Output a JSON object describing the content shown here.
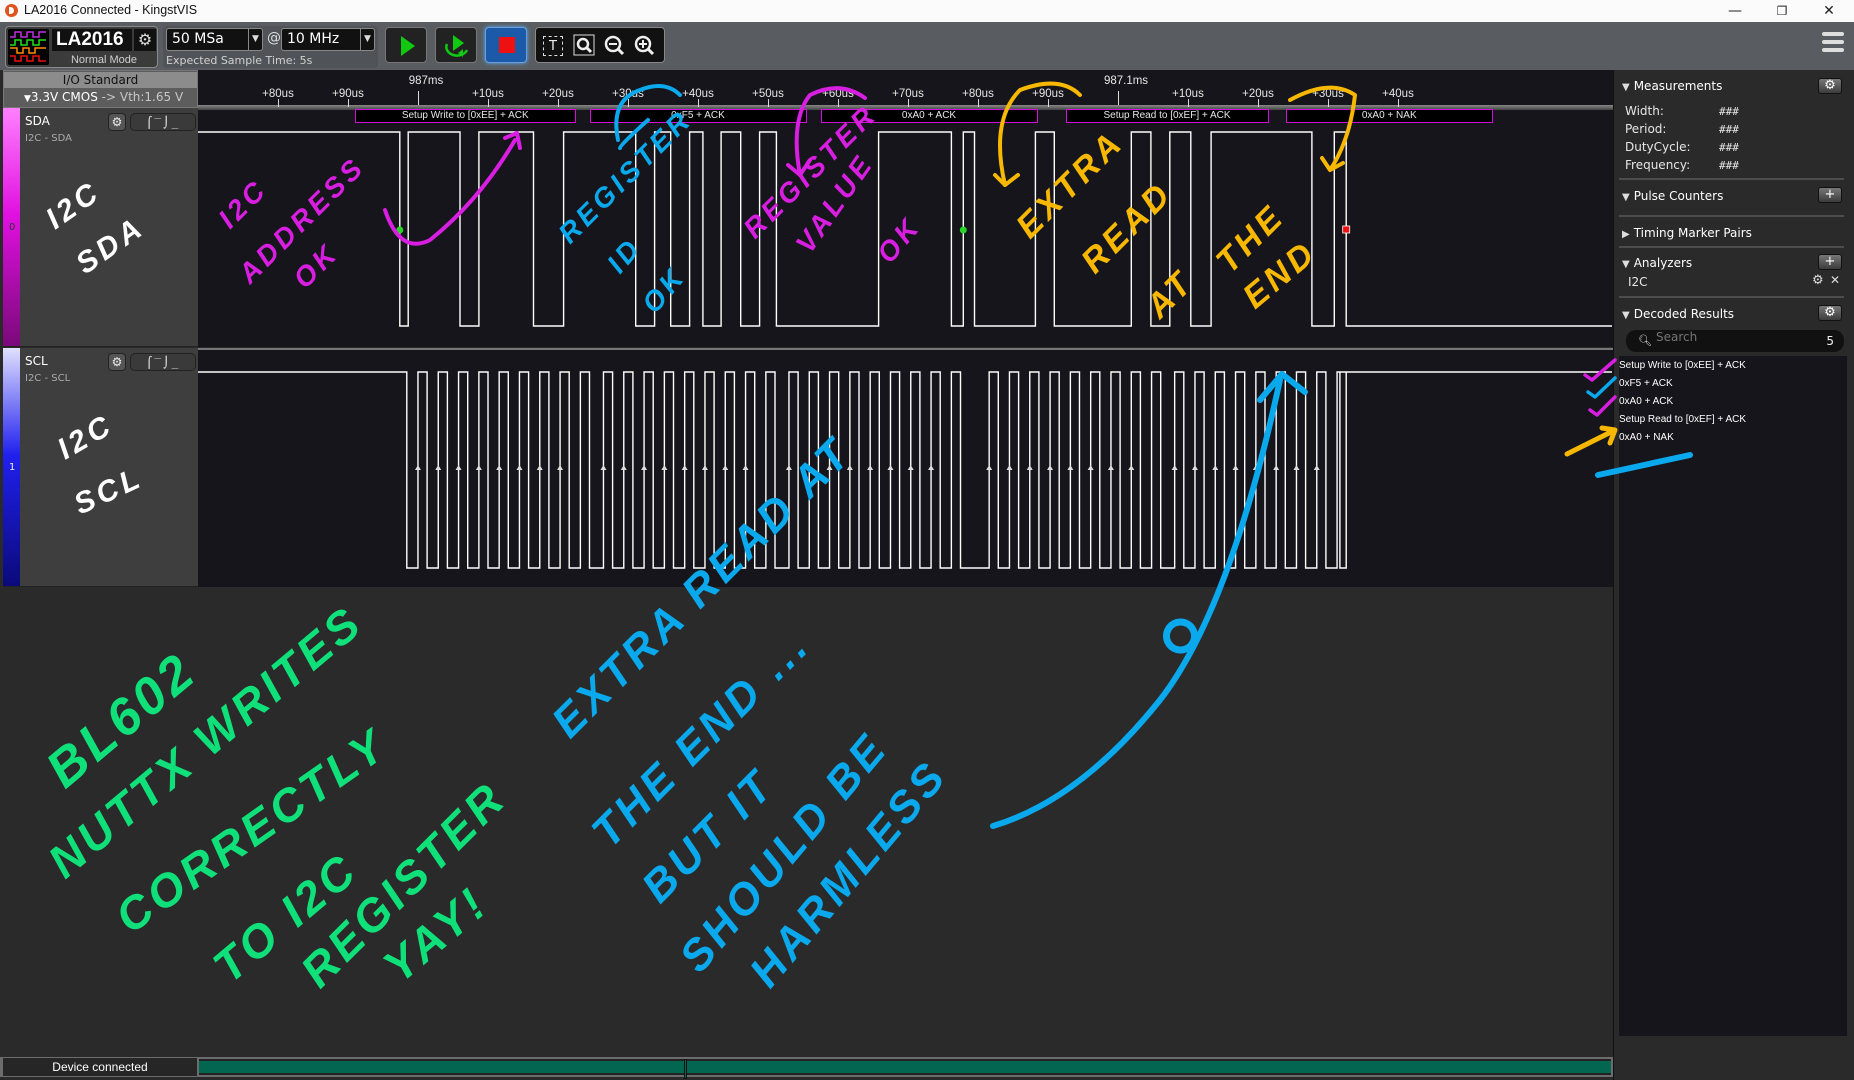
{
  "window": {
    "title": "LA2016 Connected - KingstVIS",
    "minimize": "—",
    "restore": "❐",
    "close": "✕"
  },
  "toolbar": {
    "device_name": "LA2016",
    "device_mode": "Normal Mode",
    "sample_depth": "50 MSa",
    "at_symbol": "@",
    "sample_rate": "10 MHz",
    "expected_time": "Expected Sample Time: 5s",
    "start_label": "Start",
    "repeat_label": "Repeat",
    "stop_label": "Stop",
    "colors": {
      "start": "#12c912",
      "stop_bg": "#1a5aa8",
      "stop": "#ee1111"
    }
  },
  "io_standard": {
    "label": "I/O Standard",
    "value": "3.3V CMOS",
    "threshold": "-> Vth:1.65 V"
  },
  "ruler": {
    "ticks": [
      {
        "label": "+80us",
        "t": -20
      },
      {
        "label": "+90us",
        "t": -10
      },
      {
        "label": "+10us",
        "t": 10
      },
      {
        "label": "+20us",
        "t": 20
      },
      {
        "label": "+30us",
        "t": 30
      },
      {
        "label": "+40us",
        "t": 40
      },
      {
        "label": "+50us",
        "t": 50
      },
      {
        "label": "+60us",
        "t": 60
      },
      {
        "label": "+70us",
        "t": 70
      },
      {
        "label": "+80us",
        "t": 80
      },
      {
        "label": "+90us",
        "t": 90
      },
      {
        "label": "+10us",
        "t": 110
      },
      {
        "label": "+20us",
        "t": 120
      },
      {
        "label": "+30us",
        "t": 130
      },
      {
        "label": "+40us",
        "t": 140
      }
    ],
    "anchors": [
      {
        "label": "987ms",
        "t": 0
      },
      {
        "label": "987.1ms",
        "t": 100
      }
    ],
    "unit": "us"
  },
  "channels": [
    {
      "index": "0",
      "name": "SDA",
      "subtitle": "I2C - SDA",
      "color_top": "#ff80ff",
      "color_mid": "#e010e0",
      "color_bot": "#7a0a7a",
      "note": "I2C SDA"
    },
    {
      "index": "1",
      "name": "SCL",
      "subtitle": "I2C - SCL",
      "color_top": "#e0e0ff",
      "color_mid": "#2020ee",
      "color_bot": "#0a0a7a",
      "note": "I2C SCL"
    }
  ],
  "decoded_frames": [
    {
      "label": "Setup Write to [0xEE] + ACK",
      "t_start": -9,
      "t_end": 22.5
    },
    {
      "label": "0xF5 + ACK",
      "t_start": 24.5,
      "t_end": 55.5
    },
    {
      "label": "0xA0 + ACK",
      "t_start": 57.5,
      "t_end": 88.5
    },
    {
      "label": "Setup Read to [0xEF] + ACK",
      "t_start": 92.5,
      "t_end": 121.5
    },
    {
      "label": "0xA0 + NAK",
      "t_start": 124,
      "t_end": 153.5
    }
  ],
  "signals": {
    "sda_edges_us": [
      -2.6,
      -1.4,
      6.0,
      8.7,
      16.5,
      20.8,
      31.1,
      33.8,
      36.1,
      38.8,
      40.7,
      43.3,
      46.1,
      48.8,
      51.2,
      65.8,
      76.2,
      77.9,
      79.5,
      88.2,
      90.9,
      101.9,
      104.7,
      107.4,
      110.4,
      113.3,
      127.7,
      130.9,
      132.6
    ],
    "sda_start_high": true,
    "sda_markers": [
      {
        "type": "start",
        "t": -2.6,
        "color": "#27d427"
      },
      {
        "type": "start",
        "t": 77.9,
        "color": "#27d427"
      },
      {
        "type": "stop",
        "t": 132.6,
        "color": "#ee1111"
      }
    ],
    "scl_first_fall_us": -1.6,
    "scl_period_us": 2.9,
    "scl_bytes": 5,
    "scl_gap_after_byte2_us": 2.5,
    "scl_last_rise_us": 131.7
  },
  "measurements": {
    "title": "Measurements",
    "rows": [
      {
        "label": "Width:",
        "value": "###"
      },
      {
        "label": "Period:",
        "value": "###"
      },
      {
        "label": "DutyCycle:",
        "value": "###"
      },
      {
        "label": "Frequency:",
        "value": "###"
      }
    ]
  },
  "pulse_counters": {
    "title": "Pulse Counters"
  },
  "timing_marker_pairs": {
    "title": "Timing Marker Pairs"
  },
  "analyzers": {
    "title": "Analyzers",
    "items": [
      {
        "name": "I2C"
      }
    ]
  },
  "decoded_results": {
    "title": "Decoded Results",
    "search_placeholder": "Search",
    "count": "5",
    "items": [
      "Setup Write to [0xEE] + ACK",
      "0xF5 + ACK",
      "0xA0 + ACK",
      "Setup Read to [0xEF] + ACK",
      "0xA0 + NAK"
    ]
  },
  "status": {
    "text": "Device connected",
    "progress": 1.0
  },
  "annotations": {
    "colors": {
      "magenta": "#d81ee0",
      "blue": "#0aa8ec",
      "yellow": "#f8b800",
      "green": "#10e07a",
      "white": "#ffffff"
    },
    "sda_notes": [
      {
        "text": "I2C ADDRESS OK",
        "color": "magenta"
      },
      {
        "text": "REGISTER ID OK",
        "color": "blue"
      },
      {
        "text": "REGISTER VALUE OK",
        "color": "magenta"
      },
      {
        "text": "EXTRA READ AT THE END",
        "color": "yellow"
      }
    ],
    "bottom_green": [
      "BL602",
      "NUTTX WRITES",
      "CORRECTLY",
      "TO I2C",
      "REGISTER",
      "YAY!"
    ],
    "bottom_blue": [
      "EXTRA READ AT",
      "THE END ...",
      "BUT IT",
      "SHOULD BE",
      "HARMLESS"
    ]
  }
}
